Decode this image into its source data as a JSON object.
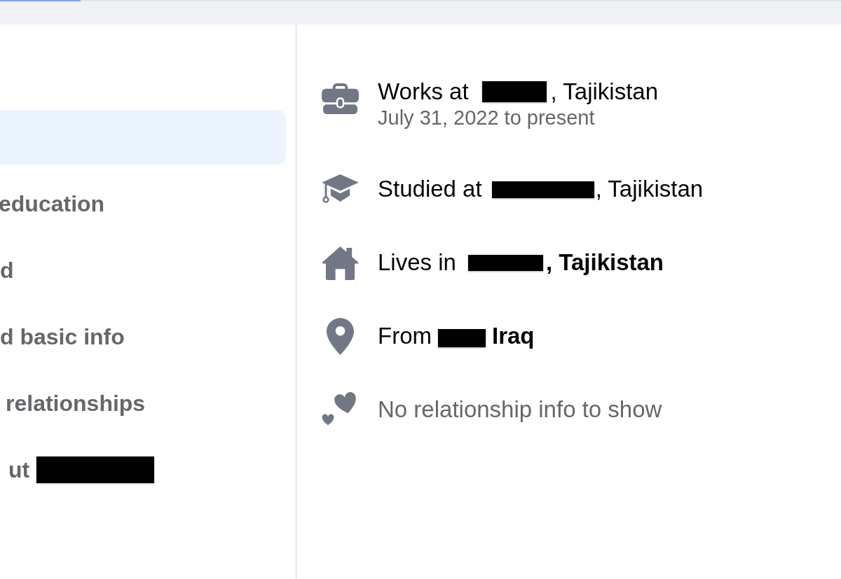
{
  "loading_bar": {
    "level": 0.096
  },
  "sidebar": {
    "items": [
      {
        "selected": true
      },
      {
        "label": "education",
        "selected": false
      },
      {
        "label": "d",
        "selected": false
      },
      {
        "label": "d basic info",
        "selected": false
      },
      {
        "label": "relationships",
        "selected": false
      },
      {
        "label": "ut",
        "redacted": true,
        "selected": false
      }
    ]
  },
  "about": {
    "rows": [
      {
        "kind": "work",
        "muted": false,
        "parts": [
          {
            "kind": "text",
            "text": "Works at",
            "bold": false
          },
          {
            "kind": "redaction"
          },
          {
            "kind": "text",
            "text": ", Tajikistan",
            "bold": false
          }
        ],
        "detail": "July 31, 2022 to present"
      },
      {
        "kind": "education",
        "muted": false,
        "parts": [
          {
            "kind": "text",
            "text": "Studied at",
            "bold": false
          },
          {
            "kind": "redaction"
          },
          {
            "kind": "text",
            "text": ", Tajikistan",
            "bold": false
          }
        ]
      },
      {
        "kind": "home",
        "muted": false,
        "parts": [
          {
            "kind": "text",
            "text": "Lives in",
            "bold": false
          },
          {
            "kind": "redaction"
          },
          {
            "kind": "text",
            "text": ", Tajikistan",
            "bold": true
          }
        ]
      },
      {
        "kind": "hometown",
        "muted": false,
        "parts": [
          {
            "kind": "text",
            "text": "From",
            "bold": false
          },
          {
            "kind": "redaction"
          },
          {
            "kind": "text",
            "text": "Iraq",
            "bold": true
          }
        ]
      },
      {
        "kind": "relationship",
        "muted": true,
        "parts": [
          {
            "kind": "text",
            "text": "No relationship info to show",
            "bold": false
          }
        ]
      }
    ]
  }
}
